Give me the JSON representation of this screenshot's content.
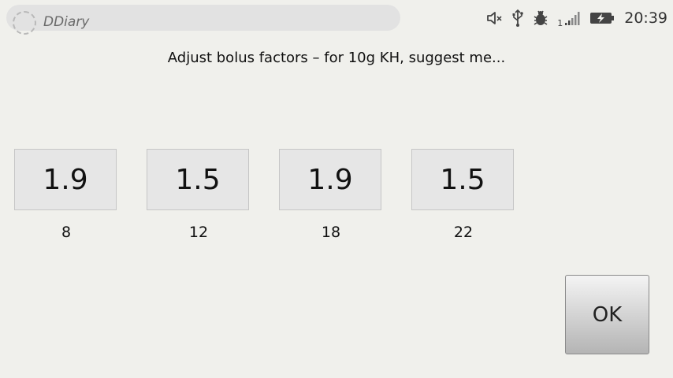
{
  "app": {
    "title": "DDiary"
  },
  "status_bar": {
    "sim_slot": "1",
    "time": "20:39",
    "icons": [
      "volume-muted-icon",
      "usb-icon",
      "debug-bug-icon",
      "signal-icon",
      "battery-charging-icon"
    ]
  },
  "dialog": {
    "prompt": "Adjust bolus factors – for 10g KH, suggest me...",
    "factors": [
      {
        "value": "1.9",
        "hour": "8"
      },
      {
        "value": "1.5",
        "hour": "12"
      },
      {
        "value": "1.9",
        "hour": "18"
      },
      {
        "value": "1.5",
        "hour": "22"
      }
    ],
    "ok_label": "OK"
  }
}
